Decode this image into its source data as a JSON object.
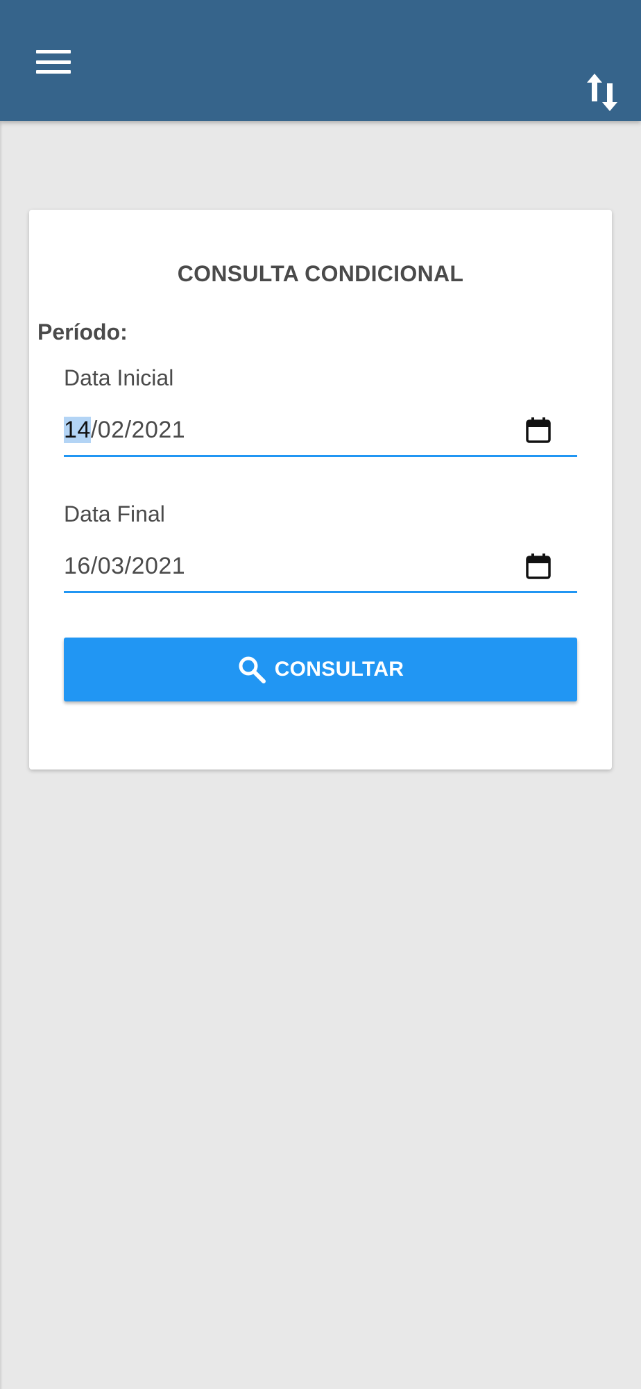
{
  "header": {
    "menu_icon": "hamburger-menu-icon",
    "sort_icon": "swap-vertical-icon",
    "background_color": "#36648b"
  },
  "card": {
    "title": "CONSULTA CONDICIONAL",
    "period_label": "Período:",
    "start_date": {
      "label": "Data Inicial",
      "day": "14",
      "rest": "/02/2021",
      "icon": "calendar-icon"
    },
    "end_date": {
      "label": "Data Final",
      "value": "16/03/2021",
      "icon": "calendar-icon"
    },
    "submit": {
      "label": "CONSULTAR",
      "icon": "search-icon",
      "color": "#2196f3"
    }
  }
}
